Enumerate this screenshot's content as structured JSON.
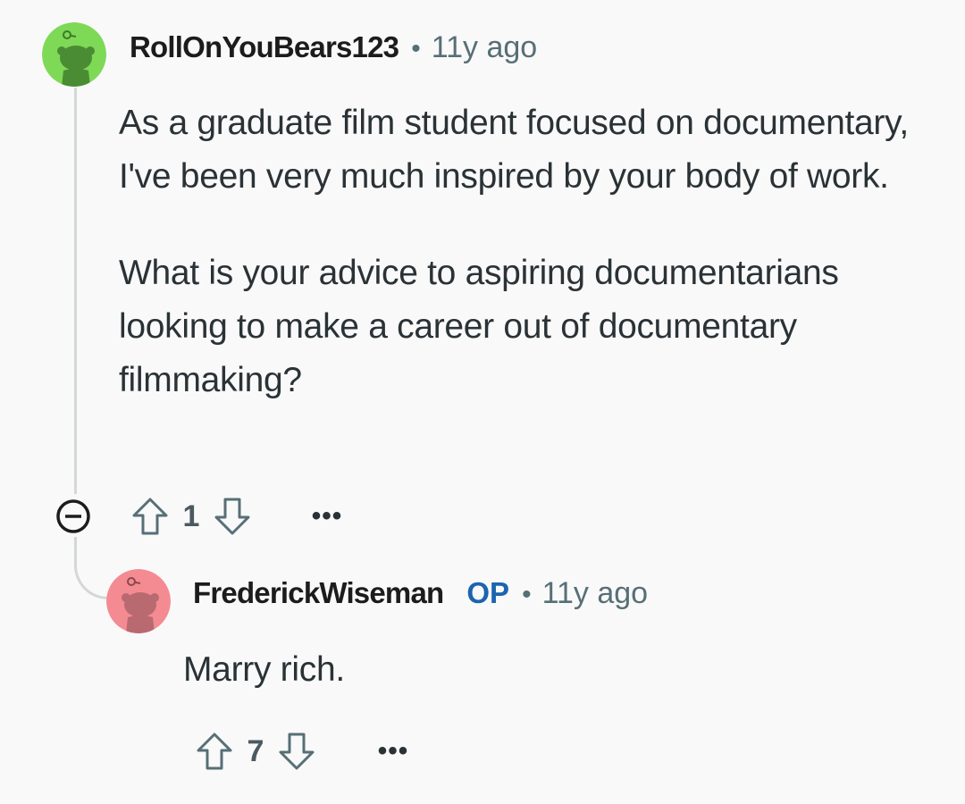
{
  "comment": {
    "username": "RollOnYouBears123",
    "time": "11y ago",
    "body": [
      "As a graduate film student focused on documentary, I've been very much inspired by your body of work.",
      "What is your advice to aspiring documentarians looking to make a career out of documentary filmmaking?"
    ],
    "votes": "1",
    "more_label": "•••",
    "avatar_color": "#7ed957",
    "avatar_icon": "snoo-avatar-icon"
  },
  "reply": {
    "username": "FrederickWiseman",
    "op_badge": "OP",
    "time": "11y ago",
    "body": "Marry rich.",
    "votes": "7",
    "more_label": "•••",
    "avatar_color": "#f48b92",
    "avatar_icon": "snoo-avatar-icon"
  },
  "separator": "•",
  "icons": {
    "collapse": "collapse-minus-icon",
    "upvote": "upvote-arrow-icon",
    "downvote": "downvote-arrow-icon",
    "more": "more-dots-icon"
  },
  "colors": {
    "background": "#f9f9f9",
    "op_badge": "#1b64b0",
    "thread_line": "#d4d7d9"
  }
}
